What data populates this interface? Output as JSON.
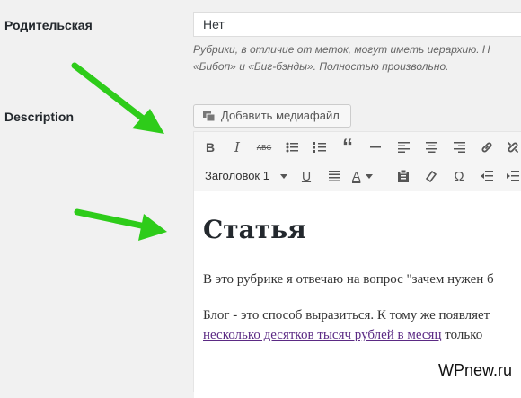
{
  "parent": {
    "label": "Родительская",
    "value": "Нет"
  },
  "hint": {
    "line1": "Рубрики, в отличие от меток, могут иметь иерархию. Н",
    "line2": "«Бибоп» и «Биг-бэнды». Полностью произвольно."
  },
  "description": {
    "label": "Description"
  },
  "media_button": {
    "label": "Добавить медиафайл"
  },
  "toolbar": {
    "format_select": "Заголовок 1",
    "row1": [
      "bold",
      "italic",
      "strikethrough",
      "bullet-list",
      "numbered-list",
      "blockquote",
      "horizontal-line",
      "align-left",
      "align-center",
      "align-right",
      "link",
      "unlink"
    ],
    "row2": [
      "underline",
      "justify",
      "text-color",
      "paste-text",
      "clear-formatting",
      "special-character",
      "outdent",
      "indent"
    ],
    "bold_glyph": "B",
    "italic_glyph": "I",
    "strike_glyph": "ABC",
    "quote_glyph": "“",
    "underline_glyph": "U",
    "color_glyph": "A",
    "omega_glyph": "Ω"
  },
  "content": {
    "heading": "Статья",
    "p1": "В это рубрике я отвечаю на вопрос \"зачем нужен б",
    "p2": "Блог - это способ выразиться. К тому же появляет",
    "p3_link": "несколько десятков тысяч рублей в месяц",
    "p3_rest": " только"
  },
  "watermark": "WPnew.ru",
  "colors": {
    "arrow": "#2ecc1a",
    "link": "#5b2a84"
  }
}
